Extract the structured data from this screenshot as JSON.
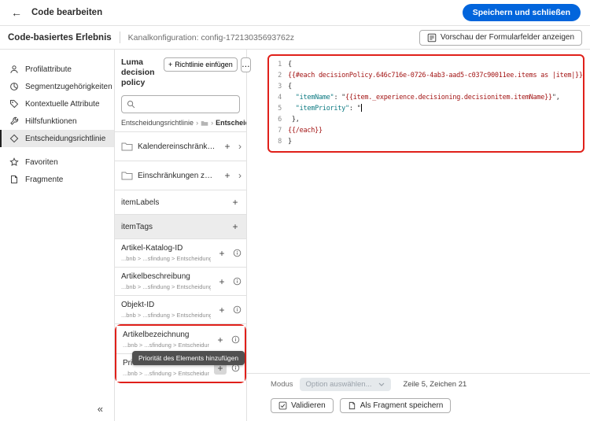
{
  "colors": {
    "accent_blue": "#0265dc",
    "annotation_red": "#e0201a",
    "token_handlebars": "#a31515",
    "token_string": "#0f7b83",
    "tooltip_bg": "#505050",
    "selected_bg": "#e9e9e9",
    "hover_bg": "#ececec"
  },
  "icons": {
    "back": "←",
    "plus": "+",
    "chevron_right": "›",
    "collapse": "«",
    "more": "…"
  },
  "header": {
    "title": "Code bearbeiten",
    "save_button": "Speichern und schließen"
  },
  "toolbar": {
    "app_title": "Code-basiertes Erlebnis",
    "channel_config": "Kanalkonfiguration: config-17213035693762z",
    "preview_button": "Vorschau der Formularfelder anzeigen"
  },
  "sidebar": {
    "items": [
      {
        "label": "Profilattribute"
      },
      {
        "label": "Segmentzugehörigkeiten"
      },
      {
        "label": "Kontextuelle Attribute"
      },
      {
        "label": "Hilfsfunktionen"
      },
      {
        "label": "Entscheidungsrichtlinie",
        "selected": true
      },
      {
        "label": "Favoriten"
      },
      {
        "label": "Fragmente"
      }
    ]
  },
  "policy_panel": {
    "title": "Luma decision policy",
    "insert_button": "Richtlinie einfügen",
    "breadcrumb": {
      "root": "Entscheidungsrichtlinie",
      "current": "Entscheidu..."
    },
    "items": [
      {
        "label": "Kalendereinschränkungen..."
      },
      {
        "label": "Einschränkungen zum Artikel"
      },
      {
        "label": "itemLabels"
      },
      {
        "label": "itemTags"
      },
      {
        "label": "Artikel-Katalog-ID",
        "path": "...bnb > ...sfindung > Entscheidungsartikel"
      },
      {
        "label": "Artikelbeschreibung",
        "path": "...bnb > ...sfindung > Entscheidungsartikel"
      },
      {
        "label": "Objekt-ID",
        "path": "...bnb > ...sfindung > Entscheidungsartikel"
      },
      {
        "label": "Artikelbezeichnung",
        "path": "...bnb > ...sfindung > Entscheidungsartikel"
      },
      {
        "label": "Priorität des Elements",
        "path": "...bnb > ...sfindung > Entscheidungsartikel"
      }
    ],
    "tooltip": "Priorität des Elements hinzufügen"
  },
  "editor": {
    "lines": [
      "{",
      "{{#each decisionPolicy.646c716e-0726-4ab3-aad5-c037c90011ee.items as |item|}}",
      "{",
      "  \"itemName\": \"{{item._experience.decisioning.decisionitem.itemName}}\",",
      "  \"itemPriority\": \"",
      " },",
      "{{/each}}",
      "}"
    ],
    "cursor": {
      "line": 5,
      "column": 21
    },
    "status": {
      "mode_label": "Modus",
      "mode_placeholder": "Option auswählen...",
      "cursor_position": "Zeile 5, Zeichen 21"
    },
    "actions": {
      "validate_button": "Validieren",
      "save_fragment_button": "Als Fragment speichern"
    }
  }
}
